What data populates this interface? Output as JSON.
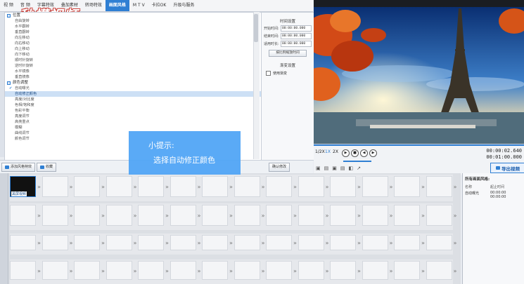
{
  "menu": {
    "items": [
      "视 频",
      "音 频",
      "字幕特效",
      "叠加素材",
      "转场特效",
      "画面风格",
      "M T V",
      "卡拉OK",
      "升级与服务"
    ],
    "active_index": 5
  },
  "logo": {
    "text": "秒懂视频"
  },
  "effects": {
    "groups": [
      {
        "label": "位置",
        "items": [
          "自由旋转",
          "水平翻转",
          "垂直翻转",
          "向左移动",
          "向右移动",
          "向上移动",
          "向下移动",
          "顺时针旋转",
          "逆时针旋转",
          "水平镜像",
          "垂直镜像"
        ]
      },
      {
        "label": "颜色调整",
        "items": [
          "自动曝光",
          "自动修正颜色",
          "亮度/对比度",
          "色相/饱和度",
          "色彩平衡",
          "亮度调节",
          "高亮重点",
          "模糊",
          "曲线调节",
          "颜色调节"
        ]
      }
    ],
    "selected": "自动修正颜色",
    "checked": "自动曝光"
  },
  "props": {
    "title": "时间设置",
    "start_label": "开始时间:",
    "start_value": "00:00:00.000",
    "end_label": "结束时间:",
    "end_value": "00:00:00.000",
    "dur_label": "适用时长:",
    "dur_value": "00:00:00.000",
    "button": "按比例缩放时间",
    "section2": "渐变设置",
    "checkbox": "使用渐变"
  },
  "toolbar": {
    "add_label": "添加风格特效",
    "del_label": "收藏",
    "apply_label": "确认修改"
  },
  "player": {
    "speeds": [
      "1/2X",
      "1X",
      "2X"
    ],
    "time_current": "00:00:02.640",
    "time_total": "00:01:00.000"
  },
  "export": {
    "label": "导出视频"
  },
  "timeline": {
    "first_clip_label": "黑屏视频"
  },
  "clip_panel": {
    "title": "所有画面风格:",
    "col1": "名称",
    "col2": "起止时间",
    "row_name": "自动曝光",
    "row_start": "00:00:00",
    "row_end": "00:00:00"
  },
  "tip": {
    "line1": "小提示:",
    "line2": "选择自动修正颜色"
  },
  "colors": {
    "accent": "#2f7fd3",
    "tip_bg": "#4ea4f5",
    "sky": "#0c3d86"
  }
}
